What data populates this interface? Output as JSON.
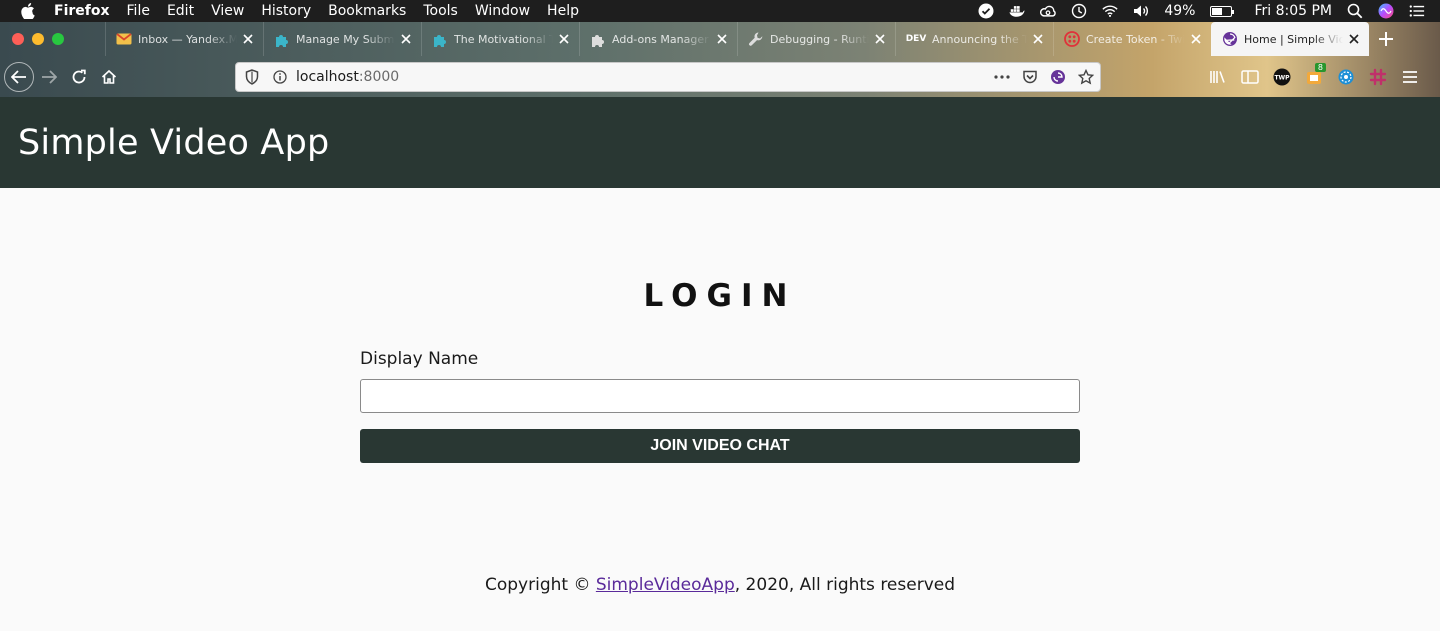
{
  "menubar": {
    "app_name": "Firefox",
    "items": [
      "File",
      "Edit",
      "View",
      "History",
      "Bookmarks",
      "Tools",
      "Window",
      "Help"
    ],
    "battery_percent": "49%",
    "battery_level": 0.49,
    "clock": "Fri 8:05 PM"
  },
  "browser": {
    "tabs": [
      {
        "title": "Inbox — Yandex.Mail",
        "icon": "mail-icon",
        "color": "#e8a33d"
      },
      {
        "title": "Manage My Submissions",
        "icon": "puzzle-icon",
        "color": "#3bb5c9"
      },
      {
        "title": "The Motivational Twilio",
        "icon": "puzzle-icon",
        "color": "#3bb5c9"
      },
      {
        "title": "Add-ons Manager",
        "icon": "addon-icon",
        "color": "#dddddd"
      },
      {
        "title": "Debugging - Runtime",
        "icon": "wrench-icon",
        "color": "#dddddd"
      },
      {
        "title": "Announcing the Twilio",
        "icon": "dev-icon",
        "icon_text": "DEV",
        "color": "#ffffff"
      },
      {
        "title": "Create Token - Twilio",
        "icon": "twilio-icon",
        "color": "#e0313a"
      },
      {
        "title": "Home | Simple Video App",
        "icon": "gatsby-icon",
        "color": "#663399",
        "active": true
      }
    ],
    "url_host": "localhost",
    "url_port": ":8000",
    "extension_badge": "8"
  },
  "page": {
    "app_title": "Simple Video App",
    "login_heading": "LOGIN",
    "display_name_label": "Display Name",
    "display_name_value": "",
    "join_button_label": "JOIN VIDEO CHAT",
    "footer_prefix": "Copyright © ",
    "footer_link": "SimpleVideoApp",
    "footer_suffix": ", 2020, All rights reserved"
  },
  "colors": {
    "header_bg": "#293733",
    "button_bg": "#293733",
    "page_bg": "#fafafa",
    "link": "#5a2a9a"
  }
}
